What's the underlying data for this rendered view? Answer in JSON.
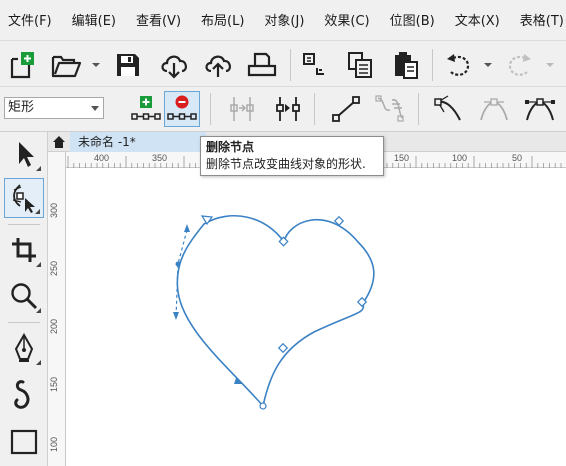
{
  "menubar": {
    "items": [
      "文件(F)",
      "编辑(E)",
      "查看(V)",
      "布局(L)",
      "对象(J)",
      "效果(C)",
      "位图(B)",
      "文本(X)",
      "表格(T)"
    ]
  },
  "toolbar": {
    "icons": [
      "new-document-icon",
      "open-folder-icon",
      "save-icon",
      "cloud-download-icon",
      "cloud-upload-icon",
      "print-icon",
      "cut-icon",
      "copy-icon",
      "paste-icon",
      "undo-icon",
      "redo-icon"
    ]
  },
  "propbar": {
    "preset_value": "矩形"
  },
  "tabs": {
    "document": "未命名 -1*",
    "add": "+"
  },
  "ruler": {
    "h_labels": [
      "400",
      "350",
      "300",
      "250",
      "200",
      "150",
      "100",
      "50"
    ],
    "v_labels": [
      "300",
      "250",
      "200",
      "150",
      "100"
    ]
  },
  "tooltip": {
    "title": "删除节点",
    "description": "删除节点改变曲线对象的形状."
  },
  "colors": {
    "curve": "#3b82c4",
    "node_add": "#1a9c3a",
    "node_delete": "#d81e1e",
    "active_highlight": "#d7e8f7"
  }
}
